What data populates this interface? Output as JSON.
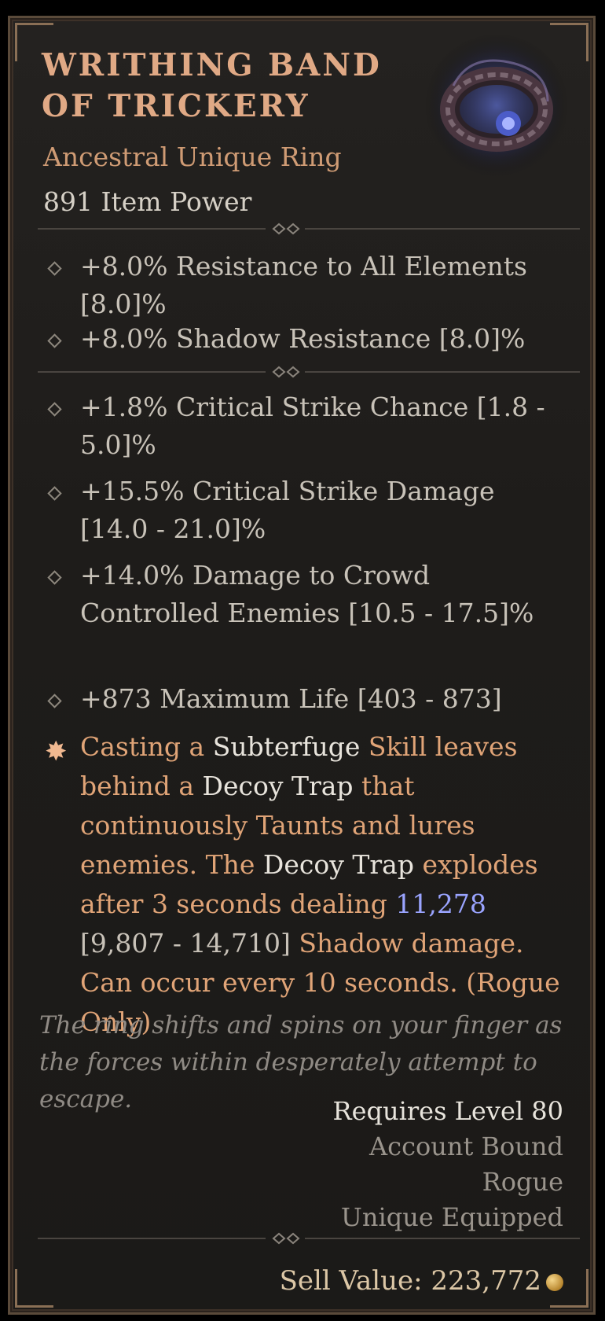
{
  "item": {
    "name_line1": "Writhing Band",
    "name_line2": "of Trickery",
    "type": "Ancestral Unique Ring",
    "item_power": "891 Item Power",
    "icon": "ring-icon"
  },
  "implicits": [
    {
      "text": "+8.0% Resistance to All Elements [8.0]%"
    },
    {
      "text": "+8.0% Shadow Resistance [8.0]%"
    }
  ],
  "affixes": [
    {
      "text": "+1.8% Critical Strike Chance [1.8 - 5.0]%"
    },
    {
      "text": "+15.5% Critical Strike Damage [14.0 - 21.0]%"
    },
    {
      "text": "+14.0% Damage to Crowd Controlled Enemies [10.5 - 17.5]%"
    },
    {
      "text": "+873 Maximum Life [403 - 873]"
    }
  ],
  "unique_affix": {
    "p1": "Casting a ",
    "h1": "Subterfuge",
    "p2": " Skill leaves behind a ",
    "h2": "Decoy Trap",
    "p3": " that continuously Taunts and lures enemies. The ",
    "h3": "Decoy Trap",
    "p4": " explodes after 3 seconds dealing ",
    "value": "11,278",
    "range": " [9,807 - 14,710]",
    "p5": " Shadow damage. Can occur every 10 seconds. (Rogue Only)"
  },
  "flavor": "The ring shifts and spins on your finger as the forces within desperately attempt to escape.",
  "requirements": {
    "level": "Requires Level 80",
    "bound": "Account Bound",
    "class": "Rogue",
    "unique": "Unique Equipped"
  },
  "sell": {
    "label": "Sell Value: 223,772",
    "icon": "gold-coin-icon"
  },
  "colors": {
    "title": "#e0a985",
    "unique_text": "#e0a477",
    "highlight": "#e8e4dc",
    "value": "#9aa4ff"
  }
}
